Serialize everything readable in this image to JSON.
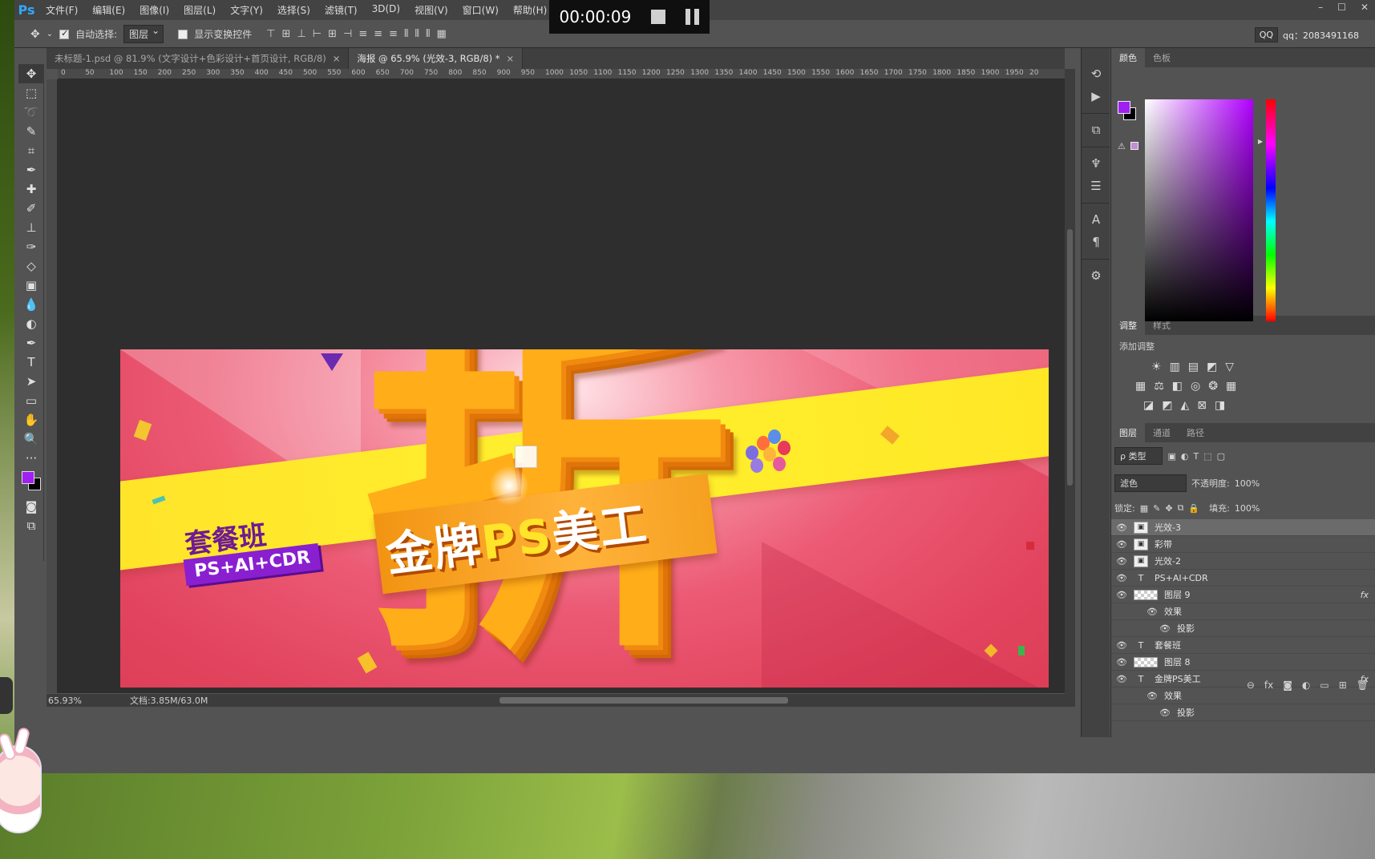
{
  "app": {
    "logo": "Ps"
  },
  "menu": [
    "文件(F)",
    "编辑(E)",
    "图像(I)",
    "图层(L)",
    "文字(Y)",
    "选择(S)",
    "滤镜(T)",
    "3D(D)",
    "视图(V)",
    "窗口(W)",
    "帮助(H)"
  ],
  "window_controls": [
    "–",
    "☐",
    "✕"
  ],
  "recorder": {
    "time": "00:00:09"
  },
  "options": {
    "auto_select_label": "自动选择:",
    "auto_select_value": "图层",
    "show_transform_label": "显示变换控件",
    "qq_box": "QQ",
    "qq_label": "qq：2083491168"
  },
  "tabs": [
    {
      "label": "未标题-1.psd @ 81.9% (文字设计+色彩设计+首页设计, RGB/8)",
      "close": "×"
    },
    {
      "label": "海报 @ 65.9% (光效-3, RGB/8) *",
      "close": "×"
    }
  ],
  "ruler_ticks": [
    "0",
    "50",
    "100",
    "150",
    "200",
    "250",
    "300",
    "350",
    "400",
    "450",
    "500",
    "550",
    "600",
    "650",
    "700",
    "750",
    "800",
    "850",
    "900",
    "950",
    "1000",
    "1050",
    "1100",
    "1150",
    "1200",
    "1250",
    "1300",
    "1350",
    "1400",
    "1450",
    "1500",
    "1550",
    "1600",
    "1650",
    "1700",
    "1750",
    "1800",
    "1850",
    "1900",
    "1950",
    "20"
  ],
  "status": {
    "zoom": "65.93%",
    "doc": "文档:3.85M/63.0M"
  },
  "banner": {
    "big_char": "折",
    "ribbon_prefix": "金牌",
    "ribbon_ps": "PS",
    "ribbon_suffix": "美工",
    "package": "套餐班",
    "subtitle": "PS+AI+CDR"
  },
  "colors": {
    "foreground": "#a020f0",
    "background": "#000000",
    "accent": "#31a8ff"
  },
  "panels": {
    "color_tabs": [
      "颜色",
      "色板"
    ],
    "adjust_tabs": [
      "调整",
      "样式"
    ],
    "adjust_title": "添加调整",
    "layer_tabs": [
      "图层",
      "通道",
      "路径"
    ],
    "filter_label": "ρ 类型",
    "blend_mode": "滤色",
    "opacity_label": "不透明度:",
    "opacity_value": "100%",
    "lock_label": "锁定:",
    "fill_label": "填充:",
    "fill_value": "100%"
  },
  "layers": [
    {
      "name": "光效-3",
      "kind": "smart",
      "selected": true
    },
    {
      "name": "彩带",
      "kind": "smart"
    },
    {
      "name": "光效-2",
      "kind": "smart"
    },
    {
      "name": "PS+AI+CDR",
      "kind": "text"
    },
    {
      "name": "图层 9",
      "kind": "pixel",
      "fx": "fx"
    },
    {
      "name": "效果",
      "kind": "effect"
    },
    {
      "name": "投影",
      "kind": "effect2"
    },
    {
      "name": "套餐班",
      "kind": "text"
    },
    {
      "name": "图层 8",
      "kind": "pixel"
    },
    {
      "name": "金牌PS美工",
      "kind": "text",
      "fx": "fx"
    },
    {
      "name": "效果",
      "kind": "effect"
    },
    {
      "name": "投影",
      "kind": "effect2"
    }
  ]
}
